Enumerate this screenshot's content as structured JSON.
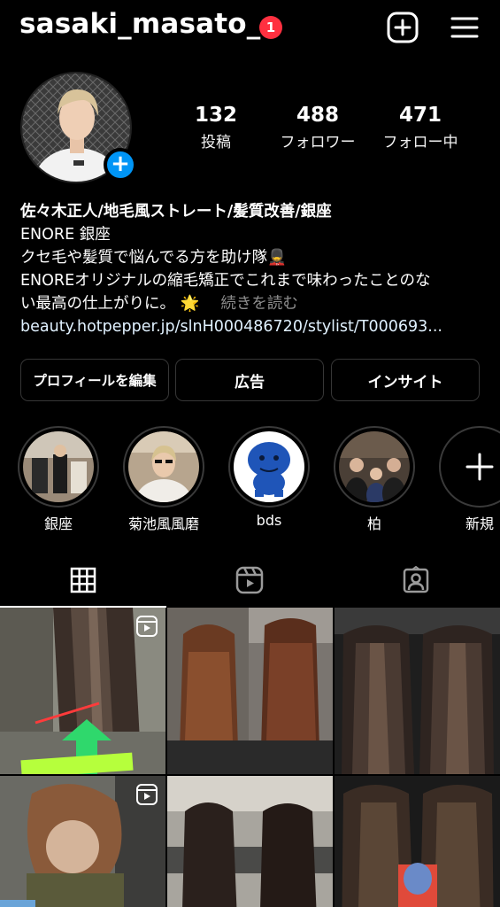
{
  "header": {
    "username": "sasaki_masato_",
    "notification_count": "1",
    "create_icon": "plus-square-icon",
    "menu_icon": "hamburger-menu-icon"
  },
  "profile": {
    "avatar_icon": "profile-photo",
    "add_story_icon": "plus-icon",
    "stats": {
      "posts": {
        "value": "132",
        "label": "投稿"
      },
      "followers": {
        "value": "488",
        "label": "フォロワー"
      },
      "following": {
        "value": "471",
        "label": "フォロー中"
      }
    }
  },
  "bio": {
    "name": "佐々木正人/地毛風ストレート/髪質改善/銀座",
    "line1": "ENORE 銀座",
    "line2": "クセ毛や髪質で悩んでる方を助け隊",
    "line2_emoji": "💂",
    "line3": "ENOREオリジナルの縮毛矯正でこれまで味わったことのな",
    "line4": "い最高の仕上がりに。",
    "line4_emoji": "🌟",
    "more": "続きを読む",
    "link": "beauty.hotpepper.jp/slnH000486720/stylist/T000693..."
  },
  "actions": {
    "edit_profile": "プロフィールを編集",
    "ads": "広告",
    "insights": "インサイト"
  },
  "highlights": [
    {
      "label": "銀座"
    },
    {
      "label": "菊池風風磨"
    },
    {
      "label": "bds"
    },
    {
      "label": "柏"
    },
    {
      "label": "新規"
    }
  ],
  "tabs": {
    "grid_icon": "grid-icon",
    "reels_icon": "reels-icon",
    "tagged_icon": "tagged-person-icon",
    "active": "grid"
  },
  "colors": {
    "background": "#000000",
    "accent_blue": "#0095f6",
    "badge_red": "#ff3040",
    "border": "#363636",
    "muted": "#8e8e8e"
  }
}
